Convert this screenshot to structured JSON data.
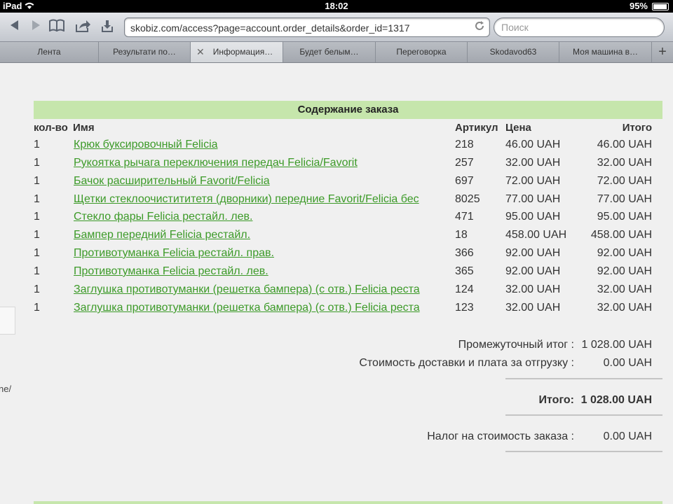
{
  "status_bar": {
    "carrier": "iPad",
    "time": "18:02",
    "battery": "95%"
  },
  "toolbar": {
    "url": "skobiz.com/access?page=account.order_details&order_id=1317",
    "search_placeholder": "Поиск"
  },
  "tabs": [
    {
      "label": "Лента",
      "active": false
    },
    {
      "label": "Результати по…",
      "active": false
    },
    {
      "label": "Информация…",
      "active": true
    },
    {
      "label": "Будет белым…",
      "active": false
    },
    {
      "label": "Переговорка",
      "active": false
    },
    {
      "label": "Skodavod63",
      "active": false
    },
    {
      "label": "Моя машина в…",
      "active": false
    }
  ],
  "page": {
    "side_text": "ne/",
    "order_header": "Содержание заказа",
    "columns": {
      "qty": "кол-во",
      "name": "Имя",
      "sku": "Артикул",
      "price": "Цена",
      "total": "Итого"
    },
    "items": [
      {
        "qty": "1",
        "name": "Крюк буксировочный Felicia",
        "sku": "218",
        "price": "46.00 UAH",
        "total": "46.00 UAH"
      },
      {
        "qty": "1",
        "name": "Рукоятка рычага переключения передач Felicia/Favorit",
        "sku": "257",
        "price": "32.00 UAH",
        "total": "32.00 UAH"
      },
      {
        "qty": "1",
        "name": "Бачок расширительный Favorit/Felicia",
        "sku": "697",
        "price": "72.00 UAH",
        "total": "72.00 UAH"
      },
      {
        "qty": "1",
        "name": "Щетки стеклоочистититетя (дворники) передние Favorit/Felicia бес",
        "sku": "8025",
        "price": "77.00 UAH",
        "total": "77.00 UAH"
      },
      {
        "qty": "1",
        "name": "Стекло фары Felicia рестайл. лев.",
        "sku": "471",
        "price": "95.00 UAH",
        "total": "95.00 UAH"
      },
      {
        "qty": "1",
        "name": "Бампер передний Felicia рестайл.",
        "sku": "18",
        "price": "458.00 UAH",
        "total": "458.00 UAH"
      },
      {
        "qty": "1",
        "name": "Противотуманка Felicia рестайл. прав.",
        "sku": "366",
        "price": "92.00 UAH",
        "total": "92.00 UAH"
      },
      {
        "qty": "1",
        "name": "Противотуманка Felicia рестайл. лев.",
        "sku": "365",
        "price": "92.00 UAH",
        "total": "92.00 UAH"
      },
      {
        "qty": "1",
        "name": "Заглушка противотуманки (решетка бампера) (с отв.) Felicia реста",
        "sku": "124",
        "price": "32.00 UAH",
        "total": "32.00 UAH"
      },
      {
        "qty": "1",
        "name": "Заглушка противотуманки (решетка бампера) (с отв.) Felicia реста",
        "sku": "123",
        "price": "32.00 UAH",
        "total": "32.00 UAH"
      }
    ],
    "summary": {
      "subtotal_label": "Промежуточный итог :",
      "subtotal_value": "1 028.00 UAH",
      "shipping_label": "Стоимость доставки и плата за отгрузку :",
      "shipping_value": "0.00 UAH",
      "total_label": "Итого:",
      "total_value": "1 028.00 UAH",
      "tax_label": "Налог на стоимость заказа :",
      "tax_value": "0.00 UAH"
    }
  },
  "colors": {
    "header_green": "#c6e6ac",
    "link_green": "#3c9a28"
  }
}
